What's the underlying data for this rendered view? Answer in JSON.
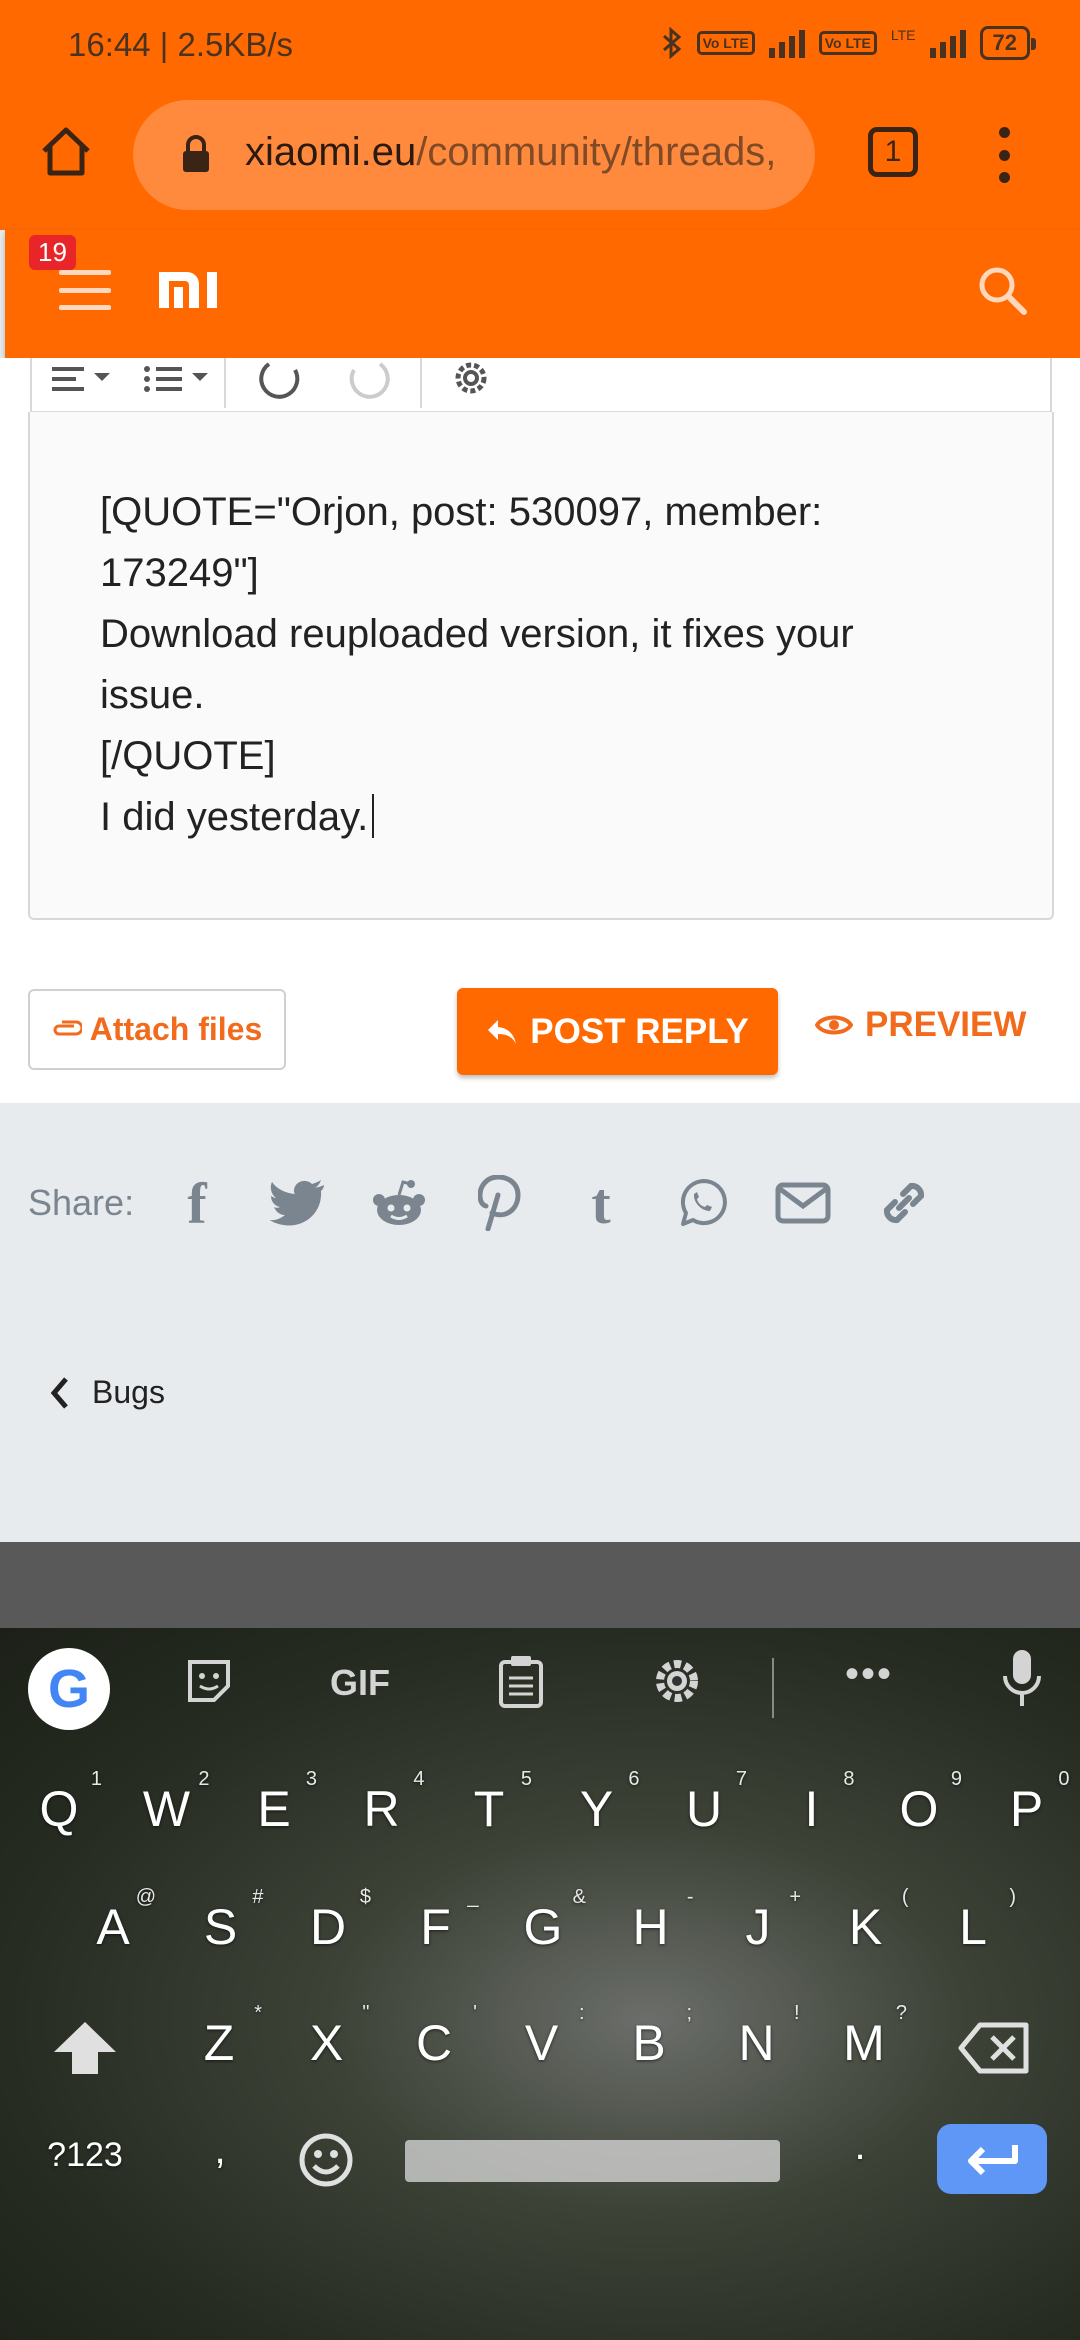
{
  "status_bar": {
    "time": "16:44 | 2.5KB/s",
    "volte_label": "Vo LTE",
    "lte_label": "LTE",
    "battery": "72"
  },
  "browser": {
    "url_domain": "xiaomi.eu",
    "url_path": "/community/threads,",
    "tab_count": "1"
  },
  "site_header": {
    "notification_count": "19",
    "logo_text": "MI"
  },
  "editor": {
    "text": "[QUOTE=\"Orjon, post: 530097, member:\n173249\"]\nDownload reuploaded version, it fixes your\nissue.\n[/QUOTE]\nI did yesterday."
  },
  "actions": {
    "attach_label": "Attach files",
    "post_reply_label": "POST REPLY",
    "preview_label": "PREVIEW"
  },
  "share": {
    "label": "Share:",
    "services": [
      "facebook",
      "twitter",
      "reddit",
      "pinterest",
      "tumblr",
      "whatsapp",
      "email",
      "link"
    ]
  },
  "breadcrumb": {
    "back_label": "Bugs"
  },
  "keyboard": {
    "gif_label": "GIF",
    "row1": [
      {
        "k": "Q",
        "s": "1"
      },
      {
        "k": "W",
        "s": "2"
      },
      {
        "k": "E",
        "s": "3"
      },
      {
        "k": "R",
        "s": "4"
      },
      {
        "k": "T",
        "s": "5"
      },
      {
        "k": "Y",
        "s": "6"
      },
      {
        "k": "U",
        "s": "7"
      },
      {
        "k": "I",
        "s": "8"
      },
      {
        "k": "O",
        "s": "9"
      },
      {
        "k": "P",
        "s": "0"
      }
    ],
    "row2": [
      {
        "k": "A",
        "s": "@"
      },
      {
        "k": "S",
        "s": "#"
      },
      {
        "k": "D",
        "s": "$"
      },
      {
        "k": "F",
        "s": "_"
      },
      {
        "k": "G",
        "s": "&"
      },
      {
        "k": "H",
        "s": "-"
      },
      {
        "k": "J",
        "s": "+"
      },
      {
        "k": "K",
        "s": "("
      },
      {
        "k": "L",
        "s": ")"
      }
    ],
    "row3": [
      {
        "k": "Z",
        "s": "*"
      },
      {
        "k": "X",
        "s": "\""
      },
      {
        "k": "C",
        "s": "'"
      },
      {
        "k": "V",
        "s": ":"
      },
      {
        "k": "B",
        "s": ";"
      },
      {
        "k": "N",
        "s": "!"
      },
      {
        "k": "M",
        "s": "?"
      }
    ],
    "symbols_label": "?123",
    "comma": ",",
    "period": "."
  },
  "colors": {
    "accent": "#ff6900",
    "link": "#f26b1d",
    "badge": "#e8262a",
    "enter": "#5e97f6"
  }
}
